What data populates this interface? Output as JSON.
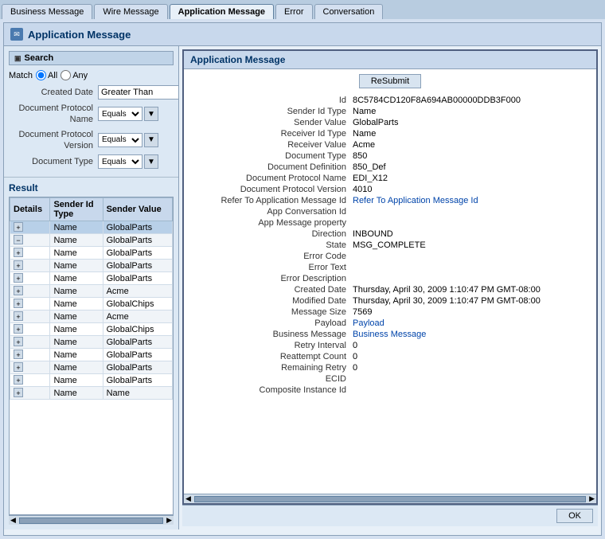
{
  "tabs": [
    {
      "label": "Business Message",
      "active": false
    },
    {
      "label": "Wire Message",
      "active": false
    },
    {
      "label": "Application Message",
      "active": true
    },
    {
      "label": "Error",
      "active": false
    },
    {
      "label": "Conversation",
      "active": false
    }
  ],
  "page": {
    "title": "Application Message"
  },
  "search": {
    "header": "Search",
    "match_label": "Match",
    "all_label": "All",
    "any_label": "Any",
    "created_date_label": "Created Date",
    "created_date_value": "Greater Than",
    "doc_protocol_name_label": "Document Protocol\nName",
    "doc_protocol_version_label": "Document Protocol\nVersion",
    "doc_type_label": "Document Type",
    "equals": "Equals"
  },
  "result": {
    "title": "Result",
    "columns": [
      "Details",
      "Sender Id\nType",
      "Sender Value"
    ],
    "rows": [
      {
        "type": "Name",
        "value": "GlobalParts",
        "selected": true
      },
      {
        "type": "Name",
        "value": "GlobalParts",
        "selected": false
      },
      {
        "type": "Name",
        "value": "GlobalParts",
        "selected": false
      },
      {
        "type": "Name",
        "value": "GlobalParts",
        "selected": false
      },
      {
        "type": "Name",
        "value": "GlobalParts",
        "selected": false
      },
      {
        "type": "Name",
        "value": "Acme",
        "selected": false
      },
      {
        "type": "Name",
        "value": "GlobalChips",
        "selected": false
      },
      {
        "type": "Name",
        "value": "Acme",
        "selected": false
      },
      {
        "type": "Name",
        "value": "GlobalChips",
        "selected": false
      },
      {
        "type": "Name",
        "value": "GlobalParts",
        "selected": false
      },
      {
        "type": "Name",
        "value": "GlobalParts",
        "selected": false
      },
      {
        "type": "Name",
        "value": "GlobalParts",
        "selected": false
      },
      {
        "type": "Name",
        "value": "GlobalParts",
        "selected": false
      },
      {
        "type": "Name",
        "value": "Name",
        "selected": false
      }
    ]
  },
  "detail": {
    "title": "Application Message",
    "resubmit_label": "ReSubmit",
    "fields": [
      {
        "label": "Id",
        "value": "8C5784CD120F8A694AB00000DDB3F000",
        "style": "normal"
      },
      {
        "label": "Sender Id Type",
        "value": "Name",
        "style": "normal"
      },
      {
        "label": "Sender Value",
        "value": "GlobalParts",
        "style": "normal"
      },
      {
        "label": "Receiver Id Type",
        "value": "Name",
        "style": "normal"
      },
      {
        "label": "Receiver Value",
        "value": "Acme",
        "style": "normal"
      },
      {
        "label": "Document Type",
        "value": "850",
        "style": "normal"
      },
      {
        "label": "Document Definition",
        "value": "850_Def",
        "style": "normal"
      },
      {
        "label": "Document Protocol Name",
        "value": "EDI_X12",
        "style": "normal"
      },
      {
        "label": "Document Protocol Version",
        "value": "4010",
        "style": "normal"
      },
      {
        "label": "Refer To Application Message Id",
        "value": "Refer To Application Message Id",
        "style": "blue"
      },
      {
        "label": "App Conversation Id",
        "value": "",
        "style": "normal"
      },
      {
        "label": "App Message property",
        "value": "",
        "style": "normal"
      },
      {
        "label": "Direction",
        "value": "INBOUND",
        "style": "normal"
      },
      {
        "label": "State",
        "value": "MSG_COMPLETE",
        "style": "normal"
      },
      {
        "label": "Error Code",
        "value": "",
        "style": "normal"
      },
      {
        "label": "Error Text",
        "value": "",
        "style": "normal"
      },
      {
        "label": "Error Description",
        "value": "",
        "style": "normal"
      },
      {
        "label": "Created Date",
        "value": "Thursday, April 30, 2009 1:10:47 PM GMT-08:00",
        "style": "normal"
      },
      {
        "label": "Modified Date",
        "value": "Thursday, April 30, 2009 1:10:47 PM GMT-08:00",
        "style": "normal"
      },
      {
        "label": "Message Size",
        "value": "7569",
        "style": "normal"
      },
      {
        "label": "Payload",
        "value": "Payload",
        "style": "blue"
      },
      {
        "label": "Business Message",
        "value": "Business Message",
        "style": "blue"
      },
      {
        "label": "Retry Interval",
        "value": "0",
        "style": "normal"
      },
      {
        "label": "Reattempt Count",
        "value": "0",
        "style": "normal"
      },
      {
        "label": "Remaining Retry",
        "value": "0",
        "style": "normal"
      },
      {
        "label": "ECID",
        "value": "",
        "style": "normal"
      },
      {
        "label": "Composite Instance Id",
        "value": "",
        "style": "normal"
      }
    ]
  },
  "ok_label": "OK"
}
